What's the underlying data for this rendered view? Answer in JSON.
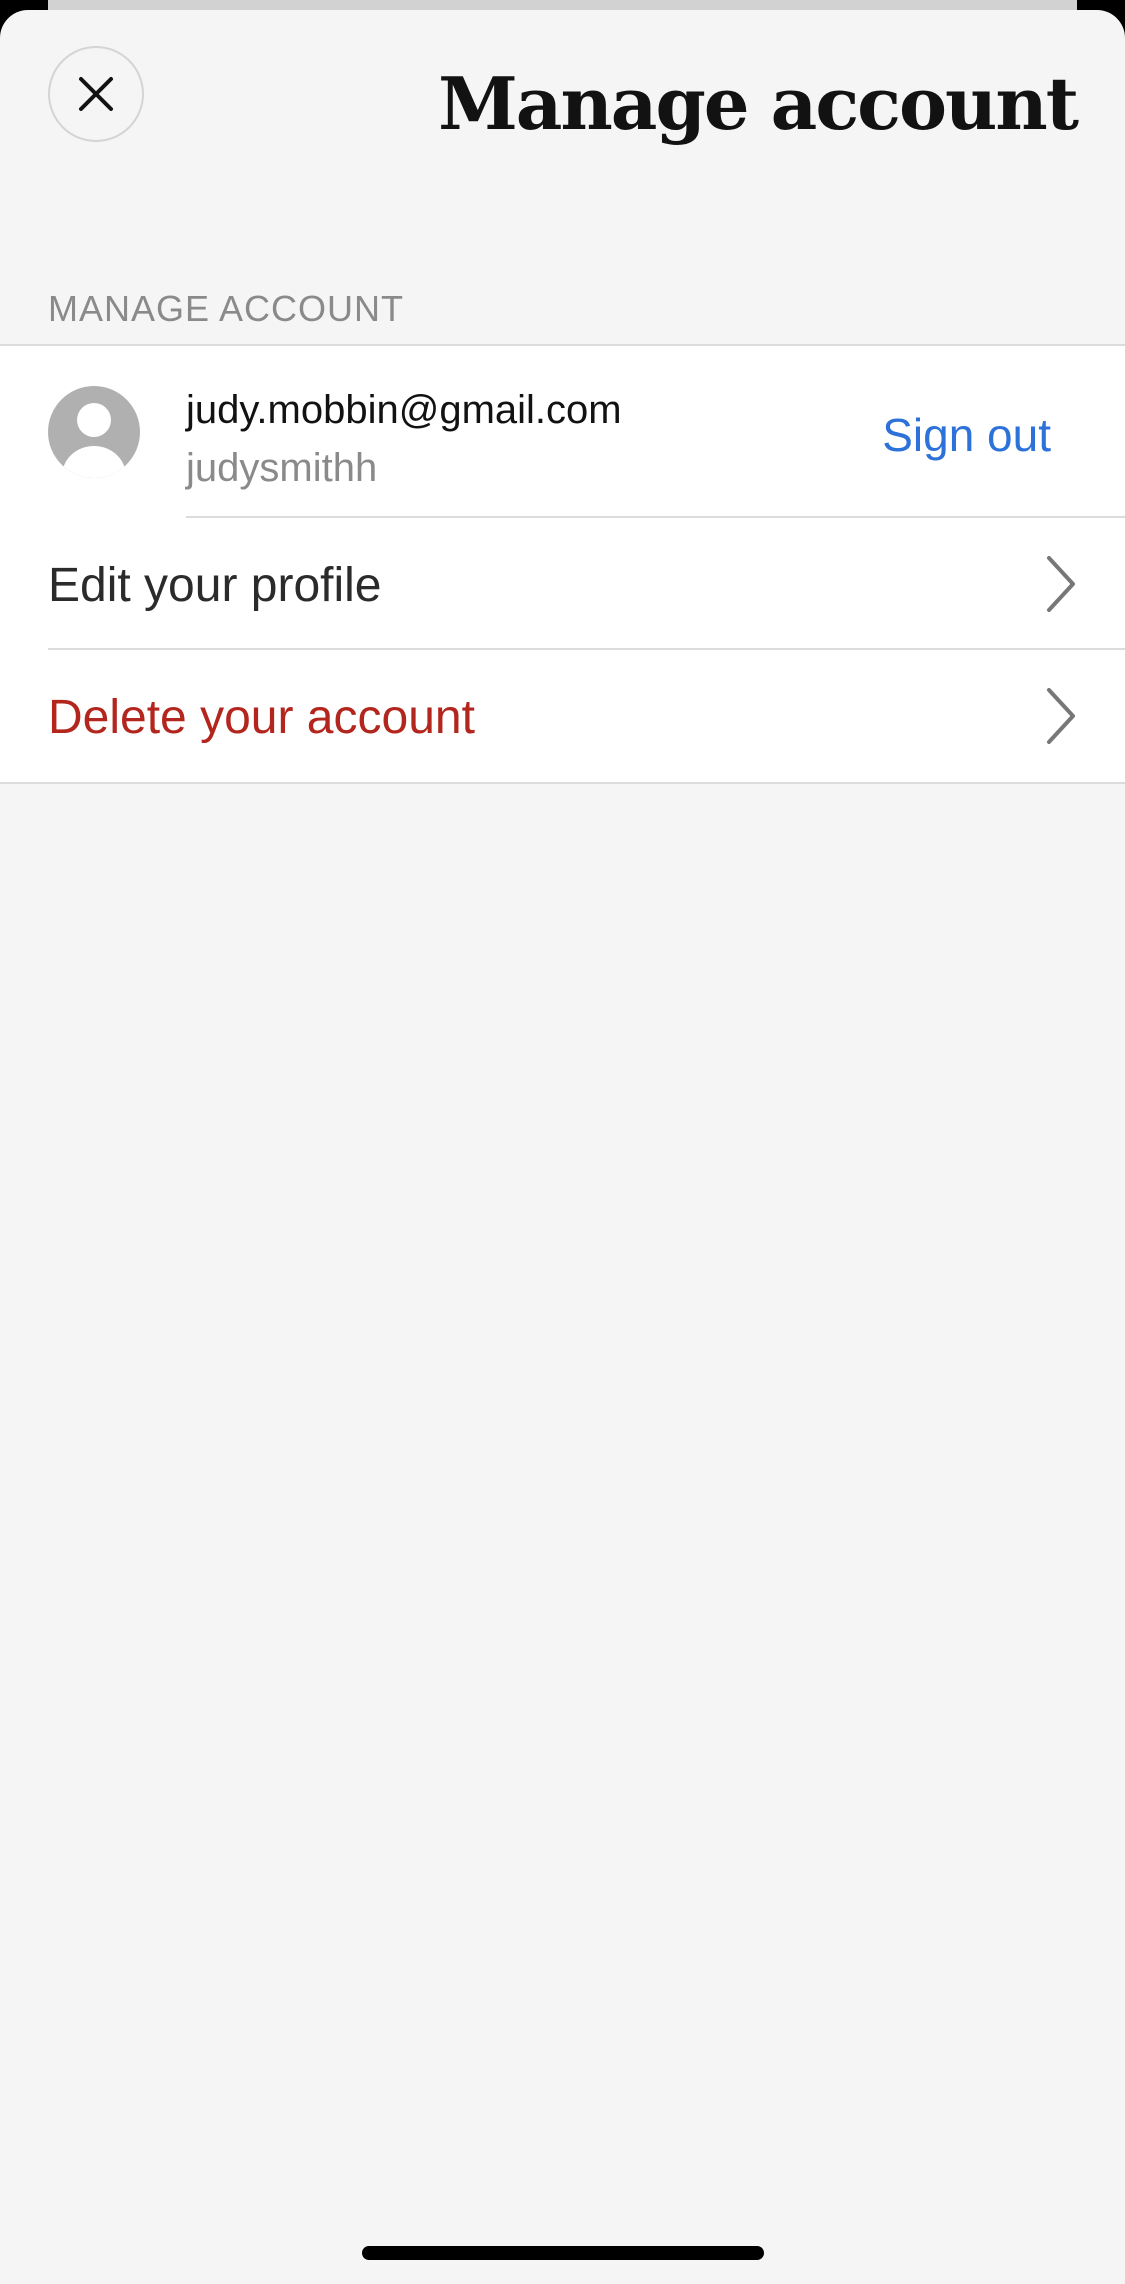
{
  "header": {
    "title": "Manage account",
    "close_icon": "close-icon"
  },
  "section": {
    "title": "MANAGE ACCOUNT"
  },
  "account": {
    "email": "judy.mobbin@gmail.com",
    "username": "judysmithh",
    "sign_out_label": "Sign out",
    "avatar_icon": "person-avatar-icon"
  },
  "menu": {
    "items": [
      {
        "label": "Edit your profile",
        "color": "#2b2b2b",
        "icon": "chevron-right-icon"
      },
      {
        "label": "Delete your account",
        "color": "#b3261e",
        "icon": "chevron-right-icon"
      }
    ]
  },
  "colors": {
    "accent": "#2d72d9",
    "destructive": "#b3261e",
    "background": "#f5f5f5"
  }
}
